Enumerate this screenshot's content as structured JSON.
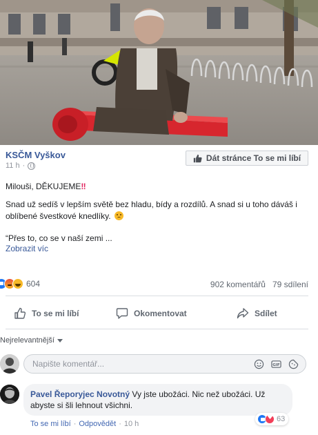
{
  "post": {
    "page_name": "KSČM Vyškov",
    "time": "11 h",
    "dot": "·",
    "like_page_label": "Dát stránce To se mi líbí",
    "text_line1": "Milouši, DĚKUJEME",
    "text_line1_emphasis": "‼",
    "text_para2": "Snad už sedíš v lepším světě bez hladu, bídy a rozdílů. A snad si u toho dáváš i oblíbené švestkové knedlíky.",
    "text_para3": "“Přes to, co se v naší zemi ...",
    "see_more": "Zobrazit víc"
  },
  "stats": {
    "reaction_count": "604",
    "comments": "902 komentářů",
    "shares": "79 sdílení"
  },
  "actions": {
    "like": "To se mi líbí",
    "comment": "Okomentovat",
    "share": "Sdílet"
  },
  "comments": {
    "sort_label": "Nejrelevantnější",
    "input_placeholder": "Napište komentář...",
    "items": [
      {
        "author": "Pavel Řeporyjec Novotný",
        "text": "Vy jste ubožáci. Nic než ubožáci. Už abyste si šli lehnout všichni.",
        "like": "To se mi líbí",
        "reply": "Odpovědět",
        "time": "10 h",
        "reaction_count": "63"
      }
    ]
  },
  "colors": {
    "link": "#385898",
    "like_blue": "#2078f4",
    "love_red": "#f33e58",
    "bench_red": "#d7262e"
  }
}
